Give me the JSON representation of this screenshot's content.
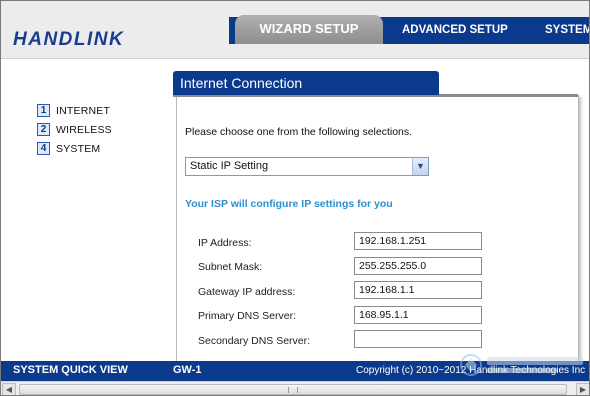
{
  "header": {
    "logo": "HANDLINK",
    "tabs": [
      {
        "label": "WIZARD SETUP",
        "active": true
      },
      {
        "label": "ADVANCED SETUP",
        "active": false
      },
      {
        "label": "SYSTEM",
        "active": false
      }
    ]
  },
  "sidebar": {
    "items": [
      {
        "num": "1",
        "label": "INTERNET"
      },
      {
        "num": "2",
        "label": "WIRELESS"
      },
      {
        "num": "4",
        "label": "SYSTEM"
      }
    ]
  },
  "panel": {
    "title": "Internet Connection",
    "prompt": "Please choose one from the following selections.",
    "connection_type": "Static IP Setting",
    "isp_note": "Your ISP will configure IP settings for you",
    "fields": [
      {
        "label": "IP Address:",
        "value": "192.168.1.251"
      },
      {
        "label": "Subnet Mask:",
        "value": "255.255.255.0"
      },
      {
        "label": "Gateway IP address:",
        "value": "192.168.1.1"
      },
      {
        "label": "Primary DNS Server:",
        "value": "168.95.1.1"
      },
      {
        "label": "Secondary DNS Server:",
        "value": ""
      }
    ]
  },
  "statusbar": {
    "quick_view": "SYSTEM QUICK VIEW",
    "model": "GW-1",
    "copyright": "Copyright (c) 2010~2012 Handlink Technologies Inc"
  },
  "icons": {
    "select_arrow": "chevron-down-icon",
    "scroll_left": "arrow-left-icon",
    "scroll_right": "arrow-right-icon"
  },
  "colors": {
    "brand_blue": "#0b3a8c",
    "note_blue": "#2b8fd0",
    "active_tab": "#9e9e9e"
  }
}
